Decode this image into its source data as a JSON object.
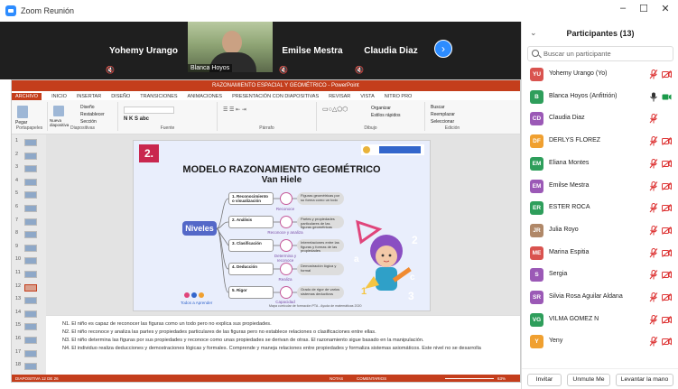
{
  "window": {
    "title": "Zoom Reunión",
    "minimize_label": "–",
    "maximize_label": "☐",
    "close_label": "✕"
  },
  "video_strip": {
    "tiles": [
      {
        "name": "Yohemy Urango",
        "muted": true
      },
      {
        "name": "Blanca Hoyos",
        "muted": false,
        "camera": true
      },
      {
        "name": "Emilse Mestra",
        "muted": true
      },
      {
        "name": "Claudia Diaz",
        "muted": true
      }
    ],
    "next_label": "›"
  },
  "shared_screen": {
    "title": "RAZONAMIENTO ESPACIAL Y GEOMÉTRICO - PowerPoint",
    "tabs": [
      "ARCHIVO",
      "INICIO",
      "INSERTAR",
      "DISEÑO",
      "TRANSICIONES",
      "ANIMACIONES",
      "PRESENTACIÓN CON DIAPOSITIVAS",
      "REVISAR",
      "VISTA",
      "NITRO PRO"
    ],
    "ribbon_groups": [
      "Portapapeles",
      "Diapositivas",
      "Fuente",
      "Párrafo",
      "Dibujo",
      "Edición"
    ],
    "ribbon_tools": [
      "Pegar",
      "Nueva diapositiva",
      "Diseño",
      "Restablecer",
      "Sección",
      "Buscar",
      "Reemplazar",
      "Seleccionar",
      "Organizar",
      "Estilos rápidos"
    ],
    "thumbnail_numbers": [
      "1",
      "2",
      "3",
      "4",
      "5",
      "6",
      "7",
      "8",
      "9",
      "10",
      "11",
      "12",
      "13",
      "14",
      "15",
      "16",
      "17",
      "18"
    ],
    "selected_slide": "12",
    "slide": {
      "number": "2.",
      "title": "MODELO RAZONAMIENTO GEOMÉTRICO",
      "subtitle": "Van Hiele",
      "root": "Niveles",
      "levels": [
        {
          "name": "1. Reconocimiento o visualización",
          "caption": "Reconoce",
          "desc": "Figuras geométricas por su forma como un todo"
        },
        {
          "name": "2. Análisis",
          "caption": "Reconoce y analiza",
          "desc": "Partes y propiedades particulares de las figuras geométricas"
        },
        {
          "name": "3. Clasificación",
          "caption": "Determina y reconoce",
          "desc": "Interrelaciones entre las figuras y formas de las propiedades"
        },
        {
          "name": "4. Deducción",
          "caption": "Realiza",
          "desc": "Demostración lógica y formal"
        },
        {
          "name": "5. Rigor",
          "caption": "Capacidad",
          "desc": "Grado de rigor de varios sistemas deductivos"
        }
      ],
      "logo_text": "Todos a Aprender",
      "footer": "Mapa curricular de formación PTA - Ayuda de matemáticas 2020"
    },
    "notes": [
      "N1. El niño es capaz de reconocer las figuras como un todo pero no explica sus propiedades.",
      "N2. El niño reconoce y analiza las partes y propiedades particulares de las figuras pero no establece relaciones o clasificaciones entre ellas.",
      "N3. El niño determina las figuras por sus propiedades y reconoce como unas propiedades se derivan de otras. El razonamiento sigue basado en la manipulación.",
      "N4. El individuo realiza deducciones y demostraciones lógicas y formales. Comprende y maneja relaciones entre propiedades y formaliza sistemas axiomáticos. Este nivel no se desarrolla"
    ],
    "status": {
      "slide_info": "DIAPOSITIVA 12 DE 26",
      "notes_label": "NOTAS",
      "comments_label": "COMENTARIOS",
      "zoom": "63%"
    }
  },
  "participants_panel": {
    "title": "Participantes (13)",
    "search_placeholder": "Buscar un participante",
    "participants": [
      {
        "initials": "YU",
        "name": "Yohemy Urango (Yo)",
        "color": "#d9534f",
        "muted": true,
        "video_off": true
      },
      {
        "initials": "B",
        "name": "Blanca Hoyos (Anfitrión)",
        "color": "#2e9e5b",
        "muted": false,
        "video_off": false
      },
      {
        "initials": "CD",
        "name": "Claudia Diaz",
        "color": "#9b59b6",
        "muted": true,
        "video_off": false
      },
      {
        "initials": "DF",
        "name": "DERLYS FLOREZ",
        "color": "#f0a030",
        "muted": true,
        "video_off": true
      },
      {
        "initials": "EM",
        "name": "Eliana Montes",
        "color": "#2e9e5b",
        "muted": true,
        "video_off": true
      },
      {
        "initials": "EM",
        "name": "Emilse Mestra",
        "color": "#9b59b6",
        "muted": true,
        "video_off": true
      },
      {
        "initials": "ER",
        "name": "ESTER ROCA",
        "color": "#2e9e5b",
        "muted": true,
        "video_off": true
      },
      {
        "initials": "JR",
        "name": "Julia Royo",
        "color": "#b08868",
        "muted": true,
        "video_off": true
      },
      {
        "initials": "ME",
        "name": "Marina Espitia",
        "color": "#d9534f",
        "muted": true,
        "video_off": true
      },
      {
        "initials": "S",
        "name": "Sergia",
        "color": "#9b59b6",
        "muted": true,
        "video_off": true
      },
      {
        "initials": "SR",
        "name": "Silvia Rosa Aguilar Aldana",
        "color": "#9b59b6",
        "muted": true,
        "video_off": true
      },
      {
        "initials": "VG",
        "name": "VILMA GOMEZ N",
        "color": "#2e9e5b",
        "muted": true,
        "video_off": true
      },
      {
        "initials": "Y",
        "name": "Yeny",
        "color": "#f0a030",
        "muted": true,
        "video_off": true
      }
    ],
    "buttons": {
      "invite": "Invitar",
      "unmute": "Unmute Me",
      "raise_hand": "Levantar la mano"
    }
  }
}
